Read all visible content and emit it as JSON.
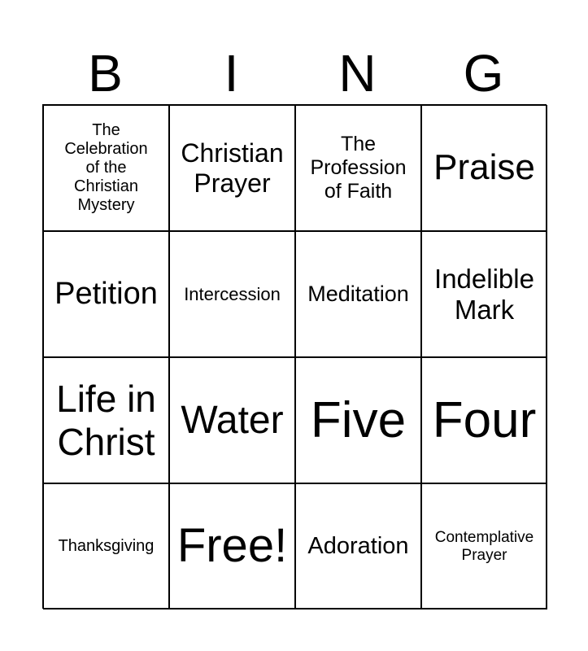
{
  "header": {
    "letters": [
      "B",
      "I",
      "N",
      "G"
    ]
  },
  "cells": [
    {
      "text": "The Celebration of the Christian Mystery",
      "size": 20
    },
    {
      "text": "Christian Prayer",
      "size": 32
    },
    {
      "text": "The Profession of Faith",
      "size": 25
    },
    {
      "text": "Praise",
      "size": 44
    },
    {
      "text": "Petition",
      "size": 38
    },
    {
      "text": "Intercession",
      "size": 22
    },
    {
      "text": "Meditation",
      "size": 27
    },
    {
      "text": "Indelible Mark",
      "size": 33
    },
    {
      "text": "Life in Christ",
      "size": 46
    },
    {
      "text": "Water",
      "size": 48
    },
    {
      "text": "Five",
      "size": 62
    },
    {
      "text": "Four",
      "size": 62
    },
    {
      "text": "Thanksgiving",
      "size": 20
    },
    {
      "text": "Free!",
      "size": 58
    },
    {
      "text": "Adoration",
      "size": 29
    },
    {
      "text": "Contemplative Prayer",
      "size": 19
    }
  ]
}
